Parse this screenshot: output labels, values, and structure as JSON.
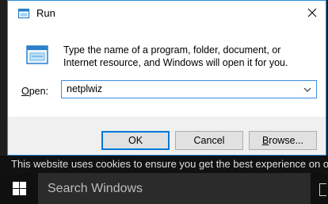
{
  "dialog": {
    "title": "Run",
    "description": "Type the name of a program, folder, document, or Internet resource, and Windows will open it for you.",
    "open_label_prefix": "",
    "open_label_hotkey": "O",
    "open_label_rest": "pen:",
    "open_value": "netplwiz",
    "buttons": {
      "ok": "OK",
      "cancel": "Cancel",
      "browse_prefix": "",
      "browse_hotkey": "B",
      "browse_rest": "rowse..."
    },
    "accent_color": "#0078d7"
  },
  "cookie_banner": {
    "text": "This website uses cookies to ensure you get the best experience on our website."
  },
  "taskbar": {
    "search_placeholder": "Search Windows"
  },
  "icons": [
    "run-icon",
    "close-icon",
    "chevron-down-icon",
    "windows-logo-icon",
    "task-view-icon"
  ]
}
